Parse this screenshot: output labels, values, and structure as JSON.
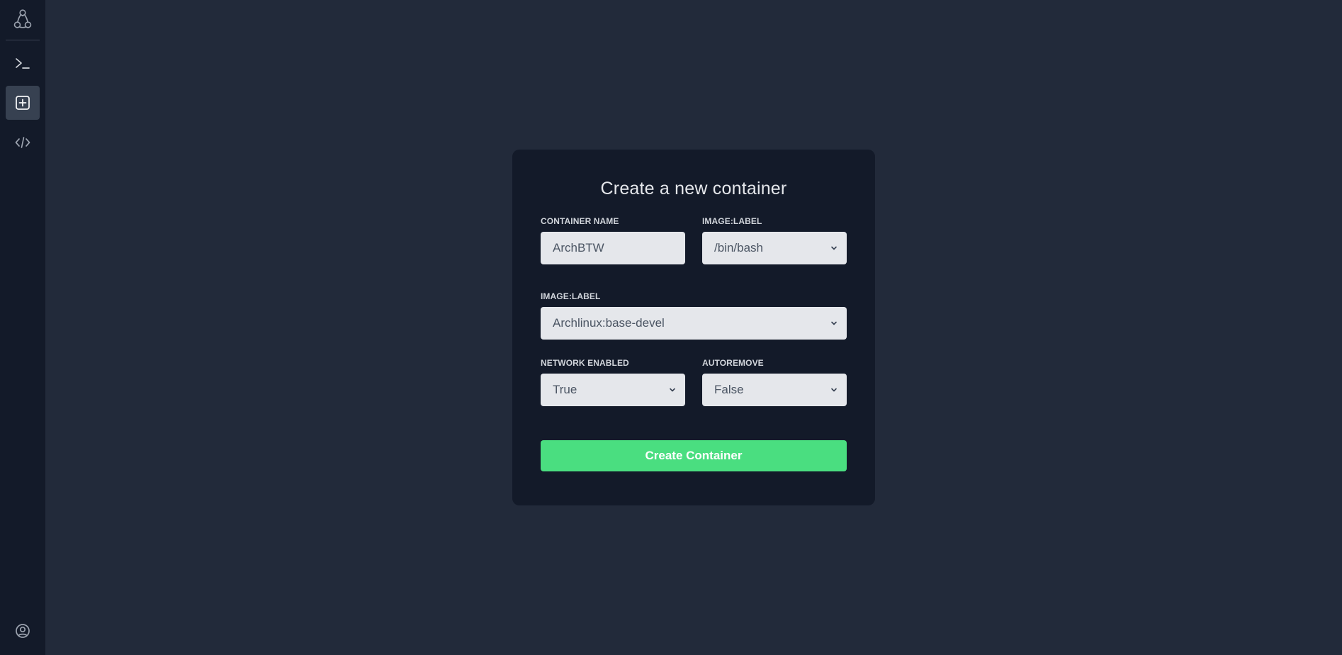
{
  "sidebar": {
    "logo": "linux-penguin-icon",
    "items": [
      {
        "name": "terminal",
        "icon": "terminal-icon",
        "active": false
      },
      {
        "name": "create-container",
        "icon": "plus-square-icon",
        "active": true
      },
      {
        "name": "code",
        "icon": "code-icon",
        "active": false
      }
    ],
    "footer": {
      "icon": "user-circle-icon"
    }
  },
  "form": {
    "title": "Create a new container",
    "container_name": {
      "label": "CONTAINER NAME",
      "value": "ArchBTW"
    },
    "shell": {
      "label": "IMAGE:LABEL",
      "value": "/bin/bash"
    },
    "image": {
      "label": "IMAGE:LABEL",
      "value": "Archlinux:base-devel"
    },
    "network": {
      "label": "NETWORK ENABLED",
      "value": "True"
    },
    "autoremove": {
      "label": "AUTOREMOVE",
      "value": "False"
    },
    "submit_label": "Create Container"
  },
  "colors": {
    "accent": "#4ade80",
    "sidebar_bg": "#131a29",
    "page_bg": "#222a3a",
    "card_bg": "#131a29"
  }
}
